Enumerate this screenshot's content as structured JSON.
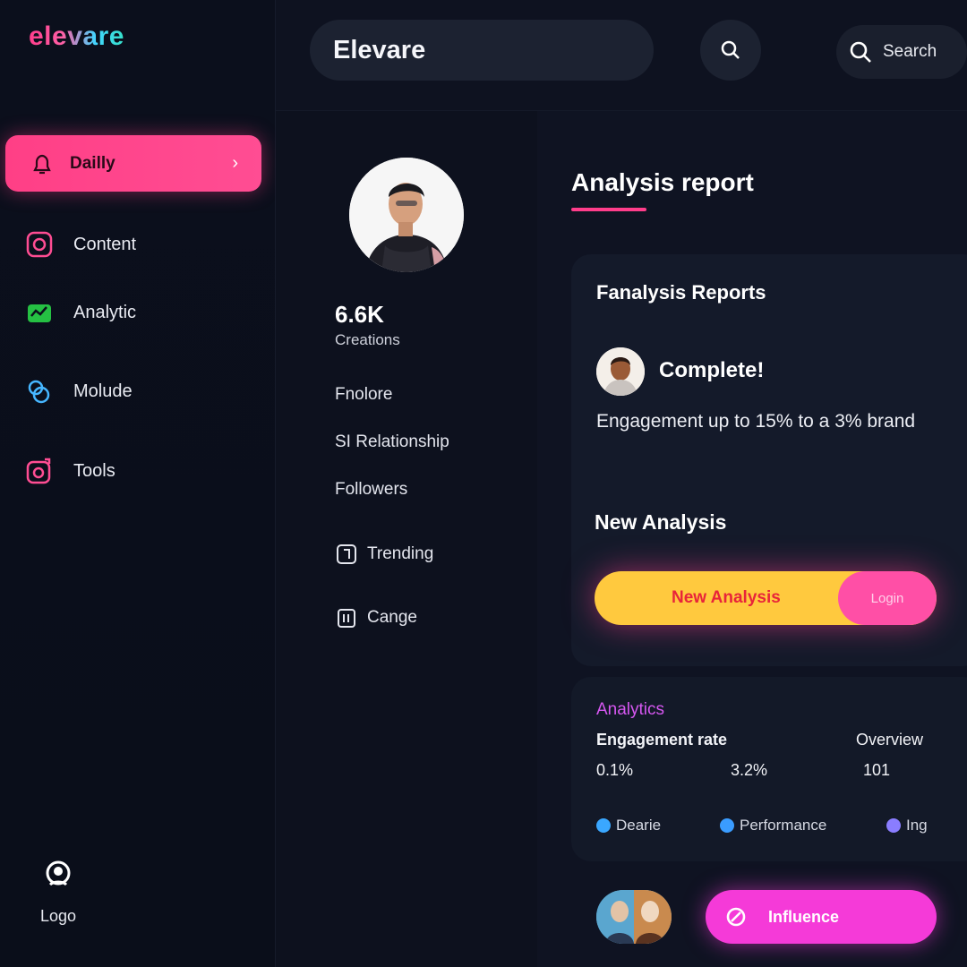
{
  "app": {
    "logo": "elevare"
  },
  "sidebar": {
    "items": [
      {
        "label": "Dailly",
        "icon": "bell-icon",
        "active": true
      },
      {
        "label": "Content",
        "icon": "content-icon"
      },
      {
        "label": "Analytic",
        "icon": "analytics-icon"
      },
      {
        "label": "Molude",
        "icon": "module-icon"
      },
      {
        "label": "Tools",
        "icon": "tools-icon"
      }
    ],
    "bottom_label": "Logo"
  },
  "header": {
    "search_value": "Elevare",
    "search2_label": "Search"
  },
  "profile": {
    "stat_value": "6.6K",
    "stat_label": "Creations",
    "links": [
      "Fnolore",
      "SI Relationship",
      "Followers"
    ],
    "icon_links": [
      {
        "label": "Trending",
        "icon": "document-icon"
      },
      {
        "label": "Cange",
        "icon": "clipboard-icon"
      }
    ]
  },
  "main": {
    "page_title": "Analysis report",
    "card": {
      "title": "Fanalysis Reports",
      "complete": "Complete!",
      "description": "Engagement up to 15% to a 3% brand",
      "section": "New Analysis",
      "cta_label": "New Analysis",
      "cta_secondary": "Login"
    },
    "analytics": {
      "heading": "Analytics",
      "col1_head": "Engagement rate",
      "col3_head": "Overview",
      "col1_val": "0.1%",
      "col2_val": "3.2%",
      "col3_val": "101",
      "legend": [
        {
          "label": "Dearie",
          "color": "#3aa7ff"
        },
        {
          "label": "Performance",
          "color": "#3a9cff"
        },
        {
          "label": "Ing",
          "color": "#8a7dff"
        }
      ]
    },
    "bottom_button": "Influence"
  },
  "colors": {
    "accent_pink": "#ff3f86",
    "accent_yellow": "#ffc93e",
    "accent_magenta": "#f53ad8",
    "background": "#0e1220"
  }
}
